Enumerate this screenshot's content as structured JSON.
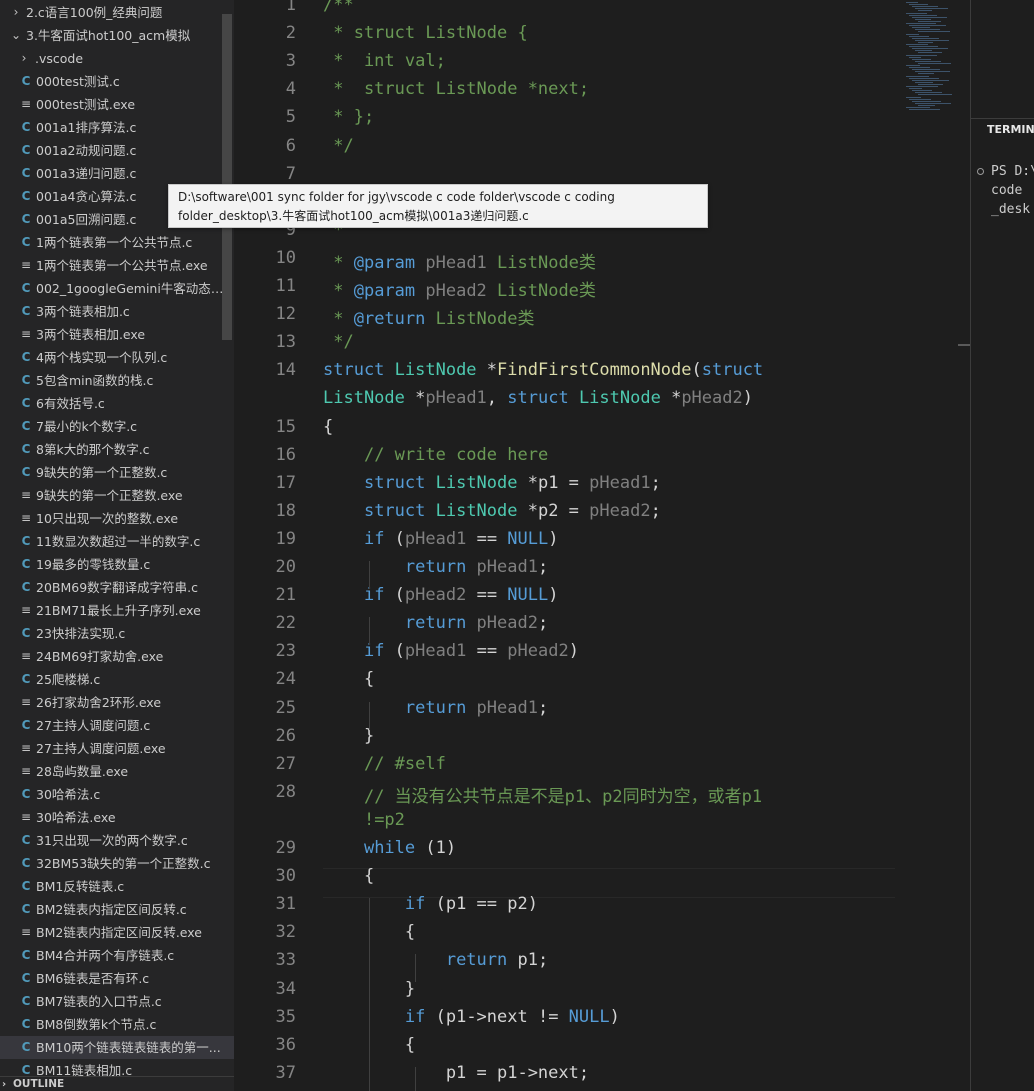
{
  "explorer": {
    "folders": [
      {
        "label": "2.c语言100例_经典问题",
        "expanded": false
      },
      {
        "label": "3.牛客面试hot100_acm模拟",
        "expanded": true
      },
      {
        "label": ".vscode",
        "expanded": false
      }
    ],
    "files": [
      {
        "label": "000test测试.c",
        "type": "c"
      },
      {
        "label": "000test测试.exe",
        "type": "exe"
      },
      {
        "label": "001a1排序算法.c",
        "type": "c"
      },
      {
        "label": "001a2动规问题.c",
        "type": "c"
      },
      {
        "label": "001a3递归问题.c",
        "type": "c"
      },
      {
        "label": "001a4贪心算法.c",
        "type": "c"
      },
      {
        "label": "001a5回溯问题.c",
        "type": "c"
      },
      {
        "label": "1两个链表第一个公共节点.c",
        "type": "c"
      },
      {
        "label": "1两个链表第一个公共节点.exe",
        "type": "exe"
      },
      {
        "label": "002_1googleGemini牛客动态规...",
        "type": "c"
      },
      {
        "label": "3两个链表相加.c",
        "type": "c"
      },
      {
        "label": "3两个链表相加.exe",
        "type": "exe"
      },
      {
        "label": "4两个栈实现一个队列.c",
        "type": "c"
      },
      {
        "label": "5包含min函数的栈.c",
        "type": "c"
      },
      {
        "label": "6有效括号.c",
        "type": "c"
      },
      {
        "label": "7最小的k个数字.c",
        "type": "c"
      },
      {
        "label": "8第k大的那个数字.c",
        "type": "c"
      },
      {
        "label": "9缺失的第一个正整数.c",
        "type": "c"
      },
      {
        "label": "9缺失的第一个正整数.exe",
        "type": "exe"
      },
      {
        "label": "10只出现一次的整数.exe",
        "type": "exe"
      },
      {
        "label": "11数显次数超过一半的数字.c",
        "type": "c"
      },
      {
        "label": "19最多的零钱数量.c",
        "type": "c"
      },
      {
        "label": "20BM69数字翻译成字符串.c",
        "type": "c"
      },
      {
        "label": "21BM71最长上升子序列.exe",
        "type": "exe"
      },
      {
        "label": "23快排法实现.c",
        "type": "c"
      },
      {
        "label": "24BM69打家劫舍.exe",
        "type": "exe"
      },
      {
        "label": "25爬楼梯.c",
        "type": "c"
      },
      {
        "label": "26打家劫舍2环形.exe",
        "type": "exe"
      },
      {
        "label": "27主持人调度问题.c",
        "type": "c"
      },
      {
        "label": "27主持人调度问题.exe",
        "type": "exe"
      },
      {
        "label": "28岛屿数量.exe",
        "type": "exe"
      },
      {
        "label": "30哈希法.c",
        "type": "c"
      },
      {
        "label": "30哈希法.exe",
        "type": "exe"
      },
      {
        "label": "31只出现一次的两个数字.c",
        "type": "c"
      },
      {
        "label": "32BM53缺失的第一个正整数.c",
        "type": "c"
      },
      {
        "label": "BM1反转链表.c",
        "type": "c"
      },
      {
        "label": "BM2链表内指定区间反转.c",
        "type": "c"
      },
      {
        "label": "BM2链表内指定区间反转.exe",
        "type": "exe"
      },
      {
        "label": "BM4合并两个有序链表.c",
        "type": "c"
      },
      {
        "label": "BM6链表是否有环.c",
        "type": "c"
      },
      {
        "label": "BM7链表的入口节点.c",
        "type": "c"
      },
      {
        "label": "BM8倒数第k个节点.c",
        "type": "c"
      },
      {
        "label": "BM10两个链表链表链表的第一...",
        "type": "c",
        "selected": true
      },
      {
        "label": "BM11链表相加.c",
        "type": "c"
      }
    ],
    "file_icons": {
      "c": "C",
      "exe": "≡"
    },
    "outline_label": "OUTLINE"
  },
  "tooltip": {
    "text": "D:\\software\\001 sync folder for jgy\\vscode c code folder\\vscode c coding folder_desktop\\3.牛客面试hot100_acm模拟\\001a3递归问题.c"
  },
  "editor": {
    "lines": [
      {
        "n": "1",
        "tokens": [
          [
            "cm",
            "/**"
          ]
        ]
      },
      {
        "n": "2",
        "tokens": [
          [
            "cm",
            " * struct ListNode {"
          ]
        ]
      },
      {
        "n": "3",
        "tokens": [
          [
            "cm",
            " *  int val;"
          ]
        ]
      },
      {
        "n": "4",
        "tokens": [
          [
            "cm",
            " *  struct ListNode *next;"
          ]
        ]
      },
      {
        "n": "5",
        "tokens": [
          [
            "cm",
            " * };"
          ]
        ]
      },
      {
        "n": "6",
        "tokens": [
          [
            "cm",
            " */"
          ]
        ]
      },
      {
        "n": "7",
        "tokens": []
      },
      {
        "n": "8",
        "tokens": []
      },
      {
        "n": "9",
        "tokens": [
          [
            "cm",
            " *"
          ]
        ]
      },
      {
        "n": "10",
        "tokens": [
          [
            "cm",
            " * "
          ],
          [
            "cmkw",
            "@param"
          ],
          [
            "dim",
            " pHead1"
          ],
          [
            "cm",
            " ListNode类"
          ]
        ]
      },
      {
        "n": "11",
        "tokens": [
          [
            "cm",
            " * "
          ],
          [
            "cmkw",
            "@param"
          ],
          [
            "dim",
            " pHead2"
          ],
          [
            "cm",
            " ListNode类"
          ]
        ]
      },
      {
        "n": "12",
        "tokens": [
          [
            "cm",
            " * "
          ],
          [
            "cmkw",
            "@return"
          ],
          [
            "cm",
            " ListNode类"
          ]
        ]
      },
      {
        "n": "13",
        "tokens": [
          [
            "cm",
            " */"
          ]
        ]
      },
      {
        "n": "14",
        "tokens": [
          [
            "kw",
            "struct "
          ],
          [
            "ty",
            "ListNode"
          ],
          [
            "plain",
            " *"
          ],
          [
            "fn",
            "FindFirstCommonNode"
          ],
          [
            "plain",
            "("
          ],
          [
            "kw",
            "struct"
          ]
        ]
      },
      {
        "n": "",
        "tokens": [
          [
            "ty",
            "ListNode"
          ],
          [
            "plain",
            " *"
          ],
          [
            "dim",
            "pHead1"
          ],
          [
            "plain",
            ", "
          ],
          [
            "kw",
            "struct "
          ],
          [
            "ty",
            "ListNode"
          ],
          [
            "plain",
            " *"
          ],
          [
            "dim",
            "pHead2"
          ],
          [
            "plain",
            ")"
          ]
        ]
      },
      {
        "n": "15",
        "tokens": [
          [
            "plain",
            "{"
          ]
        ]
      },
      {
        "n": "16",
        "tokens": [
          [
            "plain",
            "    "
          ],
          [
            "cm",
            "// write code here"
          ]
        ]
      },
      {
        "n": "17",
        "tokens": [
          [
            "plain",
            "    "
          ],
          [
            "kw",
            "struct "
          ],
          [
            "ty",
            "ListNode"
          ],
          [
            "plain",
            " *p1 = "
          ],
          [
            "dim",
            "pHead1"
          ],
          [
            "plain",
            ";"
          ]
        ]
      },
      {
        "n": "18",
        "tokens": [
          [
            "plain",
            "    "
          ],
          [
            "kw",
            "struct "
          ],
          [
            "ty",
            "ListNode"
          ],
          [
            "plain",
            " *p2 = "
          ],
          [
            "dim",
            "pHead2"
          ],
          [
            "plain",
            ";"
          ]
        ]
      },
      {
        "n": "19",
        "tokens": [
          [
            "plain",
            "    "
          ],
          [
            "kw",
            "if"
          ],
          [
            "plain",
            " ("
          ],
          [
            "dim",
            "pHead1"
          ],
          [
            "plain",
            " == "
          ],
          [
            "kw",
            "NULL"
          ],
          [
            "plain",
            ")"
          ]
        ]
      },
      {
        "n": "20",
        "tokens": [
          [
            "plain",
            "        "
          ],
          [
            "kw",
            "return "
          ],
          [
            "dim",
            "pHead1"
          ],
          [
            "plain",
            ";"
          ]
        ]
      },
      {
        "n": "21",
        "tokens": [
          [
            "plain",
            "    "
          ],
          [
            "kw",
            "if"
          ],
          [
            "plain",
            " ("
          ],
          [
            "dim",
            "pHead2"
          ],
          [
            "plain",
            " == "
          ],
          [
            "kw",
            "NULL"
          ],
          [
            "plain",
            ")"
          ]
        ]
      },
      {
        "n": "22",
        "tokens": [
          [
            "plain",
            "        "
          ],
          [
            "kw",
            "return "
          ],
          [
            "dim",
            "pHead2"
          ],
          [
            "plain",
            ";"
          ]
        ]
      },
      {
        "n": "23",
        "tokens": [
          [
            "plain",
            "    "
          ],
          [
            "kw",
            "if"
          ],
          [
            "plain",
            " ("
          ],
          [
            "dim",
            "pHead1"
          ],
          [
            "plain",
            " == "
          ],
          [
            "dim",
            "pHead2"
          ],
          [
            "plain",
            ")"
          ]
        ]
      },
      {
        "n": "24",
        "tokens": [
          [
            "plain",
            "    {"
          ]
        ]
      },
      {
        "n": "25",
        "tokens": [
          [
            "plain",
            "        "
          ],
          [
            "kw",
            "return "
          ],
          [
            "dim",
            "pHead1"
          ],
          [
            "plain",
            ";"
          ]
        ]
      },
      {
        "n": "26",
        "tokens": [
          [
            "plain",
            "    }"
          ]
        ]
      },
      {
        "n": "27",
        "tokens": [
          [
            "plain",
            "    "
          ],
          [
            "cm",
            "// #self"
          ]
        ]
      },
      {
        "n": "28",
        "tokens": [
          [
            "plain",
            "    "
          ],
          [
            "cm",
            "// 当没有公共节点是不是p1、p2同时为空，或者p1"
          ]
        ]
      },
      {
        "n": "",
        "tokens": [
          [
            "plain",
            "    "
          ],
          [
            "cm",
            "!=p2"
          ]
        ]
      },
      {
        "n": "29",
        "tokens": [
          [
            "plain",
            "    "
          ],
          [
            "kw",
            "while"
          ],
          [
            "plain",
            " (1)"
          ]
        ]
      },
      {
        "n": "30",
        "tokens": [
          [
            "plain",
            "    {"
          ]
        ]
      },
      {
        "n": "31",
        "tokens": [
          [
            "plain",
            "        "
          ],
          [
            "kw",
            "if"
          ],
          [
            "plain",
            " (p1 == p2)"
          ]
        ]
      },
      {
        "n": "32",
        "tokens": [
          [
            "plain",
            "        {"
          ]
        ]
      },
      {
        "n": "33",
        "tokens": [
          [
            "plain",
            "            "
          ],
          [
            "kw",
            "return"
          ],
          [
            "plain",
            " p1;"
          ]
        ]
      },
      {
        "n": "34",
        "tokens": [
          [
            "plain",
            "        }"
          ]
        ]
      },
      {
        "n": "35",
        "tokens": [
          [
            "plain",
            "        "
          ],
          [
            "kw",
            "if"
          ],
          [
            "plain",
            " (p1->next != "
          ],
          [
            "kw",
            "NULL"
          ],
          [
            "plain",
            ")"
          ]
        ]
      },
      {
        "n": "36",
        "tokens": [
          [
            "plain",
            "        {"
          ]
        ]
      },
      {
        "n": "37",
        "tokens": [
          [
            "plain",
            "            p1 = p1->next;"
          ]
        ]
      }
    ]
  },
  "terminal": {
    "tab_label": "TERMINAL",
    "lines": [
      "PS D:\\",
      "code ",
      "_desk"
    ]
  },
  "colors": {
    "sidebar_bg": "#252526",
    "editor_bg": "#1e1e1e",
    "keyword": "#569cd6",
    "type": "#4ec9b0",
    "function": "#dcdcaa",
    "comment": "#6a9955",
    "c_file_icon": "#519aba"
  }
}
